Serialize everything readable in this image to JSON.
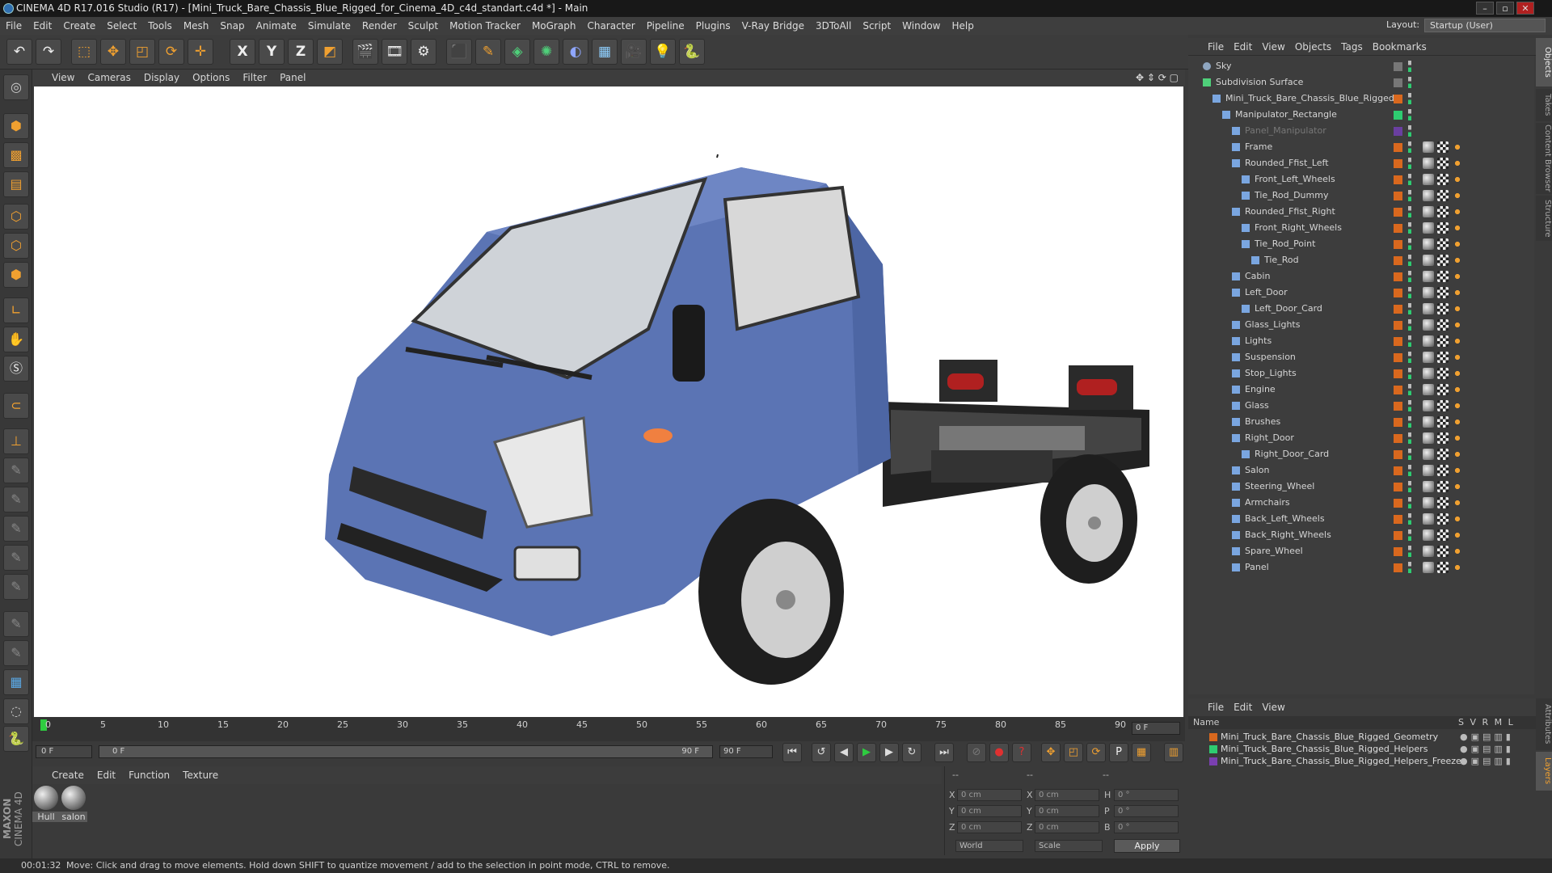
{
  "app": {
    "title": "CINEMA 4D R17.016 Studio (R17) - [Mini_Truck_Bare_Chassis_Blue_Rigged_for_Cinema_4D_c4d_standart.c4d *] - Main",
    "window_buttons": [
      "–",
      "▫",
      "✕"
    ],
    "brand_line1": "MAXON",
    "brand_line2": "CINEMA 4D"
  },
  "menubar": [
    "File",
    "Edit",
    "Create",
    "Select",
    "Tools",
    "Mesh",
    "Snap",
    "Animate",
    "Simulate",
    "Render",
    "Sculpt",
    "Motion Tracker",
    "MoGraph",
    "Character",
    "Pipeline",
    "Plugins",
    "V-Ray Bridge",
    "3DToAll",
    "Script",
    "Window",
    "Help"
  ],
  "layout": {
    "label": "Layout:",
    "value": "Startup (User)"
  },
  "toolbar": {
    "undo": "↶",
    "redo": "↷",
    "axis_x": "X",
    "axis_y": "Y",
    "axis_z": "Z"
  },
  "viewport": {
    "menu": [
      "View",
      "Cameras",
      "Display",
      "Options",
      "Filter",
      "Panel"
    ],
    "nav_icons": "✥ ⇕ ⟳ ▢"
  },
  "timeline": {
    "ticks": [
      "0",
      "5",
      "10",
      "15",
      "20",
      "25",
      "30",
      "35",
      "40",
      "45",
      "50",
      "55",
      "60",
      "65",
      "70",
      "75",
      "80",
      "85",
      "90"
    ],
    "current_frame": "0 F",
    "start_field": "0 F",
    "range_start": "0 F",
    "range_end": "90 F",
    "end_field": "90 F"
  },
  "materials": {
    "menu": [
      "Create",
      "Edit",
      "Function",
      "Texture"
    ],
    "items": [
      "Hull",
      "salon"
    ]
  },
  "coordinates": {
    "rows": [
      {
        "a": "X",
        "av": "0 cm",
        "b": "X",
        "bv": "0 cm",
        "c": "H",
        "cv": "0 °"
      },
      {
        "a": "Y",
        "av": "0 cm",
        "b": "Y",
        "bv": "0 cm",
        "c": "P",
        "cv": "0 °"
      },
      {
        "a": "Z",
        "av": "0 cm",
        "b": "Z",
        "bv": "0 cm",
        "c": "B",
        "cv": "0 °"
      }
    ],
    "dash1": "--",
    "dash2": "--",
    "dash3": "--",
    "mode1": "World",
    "mode2": "Scale",
    "apply": "Apply"
  },
  "object_manager": {
    "menu": [
      "File",
      "Edit",
      "View",
      "Objects",
      "Tags",
      "Bookmarks"
    ],
    "objects": [
      {
        "name": "Sky",
        "indent": 0
      },
      {
        "name": "Subdivision Surface",
        "indent": 0
      },
      {
        "name": "Mini_Truck_Bare_Chassis_Blue_Rigged",
        "indent": 1
      },
      {
        "name": "Manipulator_Rectangle",
        "indent": 2
      },
      {
        "name": "Panel_Manipulator",
        "indent": 3
      },
      {
        "name": "Frame",
        "indent": 3
      },
      {
        "name": "Rounded_Ffist_Left",
        "indent": 3
      },
      {
        "name": "Front_Left_Wheels",
        "indent": 4
      },
      {
        "name": "Tie_Rod_Dummy",
        "indent": 4
      },
      {
        "name": "Rounded_Ffist_Right",
        "indent": 3
      },
      {
        "name": "Front_Right_Wheels",
        "indent": 4
      },
      {
        "name": "Tie_Rod_Point",
        "indent": 4
      },
      {
        "name": "Tie_Rod",
        "indent": 5
      },
      {
        "name": "Cabin",
        "indent": 3
      },
      {
        "name": "Left_Door",
        "indent": 3
      },
      {
        "name": "Left_Door_Card",
        "indent": 4
      },
      {
        "name": "Glass_Lights",
        "indent": 3
      },
      {
        "name": "Lights",
        "indent": 3
      },
      {
        "name": "Suspension",
        "indent": 3
      },
      {
        "name": "Stop_Lights",
        "indent": 3
      },
      {
        "name": "Engine",
        "indent": 3
      },
      {
        "name": "Glass",
        "indent": 3
      },
      {
        "name": "Brushes",
        "indent": 3
      },
      {
        "name": "Right_Door",
        "indent": 3
      },
      {
        "name": "Right_Door_Card",
        "indent": 4
      },
      {
        "name": "Salon",
        "indent": 3
      },
      {
        "name": "Steering_Wheel",
        "indent": 3
      },
      {
        "name": "Armchairs",
        "indent": 3
      },
      {
        "name": "Back_Left_Wheels",
        "indent": 3
      },
      {
        "name": "Back_Right_Wheels",
        "indent": 3
      },
      {
        "name": "Spare_Wheel",
        "indent": 3
      },
      {
        "name": "Panel",
        "indent": 3
      }
    ],
    "side_tabs": [
      "Objects",
      "Takes",
      "Content Browser",
      "Structure"
    ]
  },
  "layer_manager": {
    "menu": [
      "File",
      "Edit",
      "View"
    ],
    "columns": {
      "name": "Name",
      "flags": "S V R M L"
    },
    "layers": [
      {
        "name": "Mini_Truck_Bare_Chassis_Blue_Rigged_Geometry",
        "color": "#d9681e"
      },
      {
        "name": "Mini_Truck_Bare_Chassis_Blue_Rigged_Helpers",
        "color": "#2ecc71"
      },
      {
        "name": "Mini_Truck_Bare_Chassis_Blue_Rigged_Helpers_Freeze",
        "color": "#7a3fb0"
      }
    ],
    "side_tabs": [
      "Attributes",
      "Layers"
    ]
  },
  "status": {
    "time": "00:01:32",
    "message": "Move: Click and drag to move elements. Hold down SHIFT to quantize movement / add to the selection in point mode, CTRL to remove."
  },
  "colors": {
    "truck_blue": "#5b74b4",
    "accent_orange": "#f0a030",
    "green_playhead": "#2ecc40"
  }
}
